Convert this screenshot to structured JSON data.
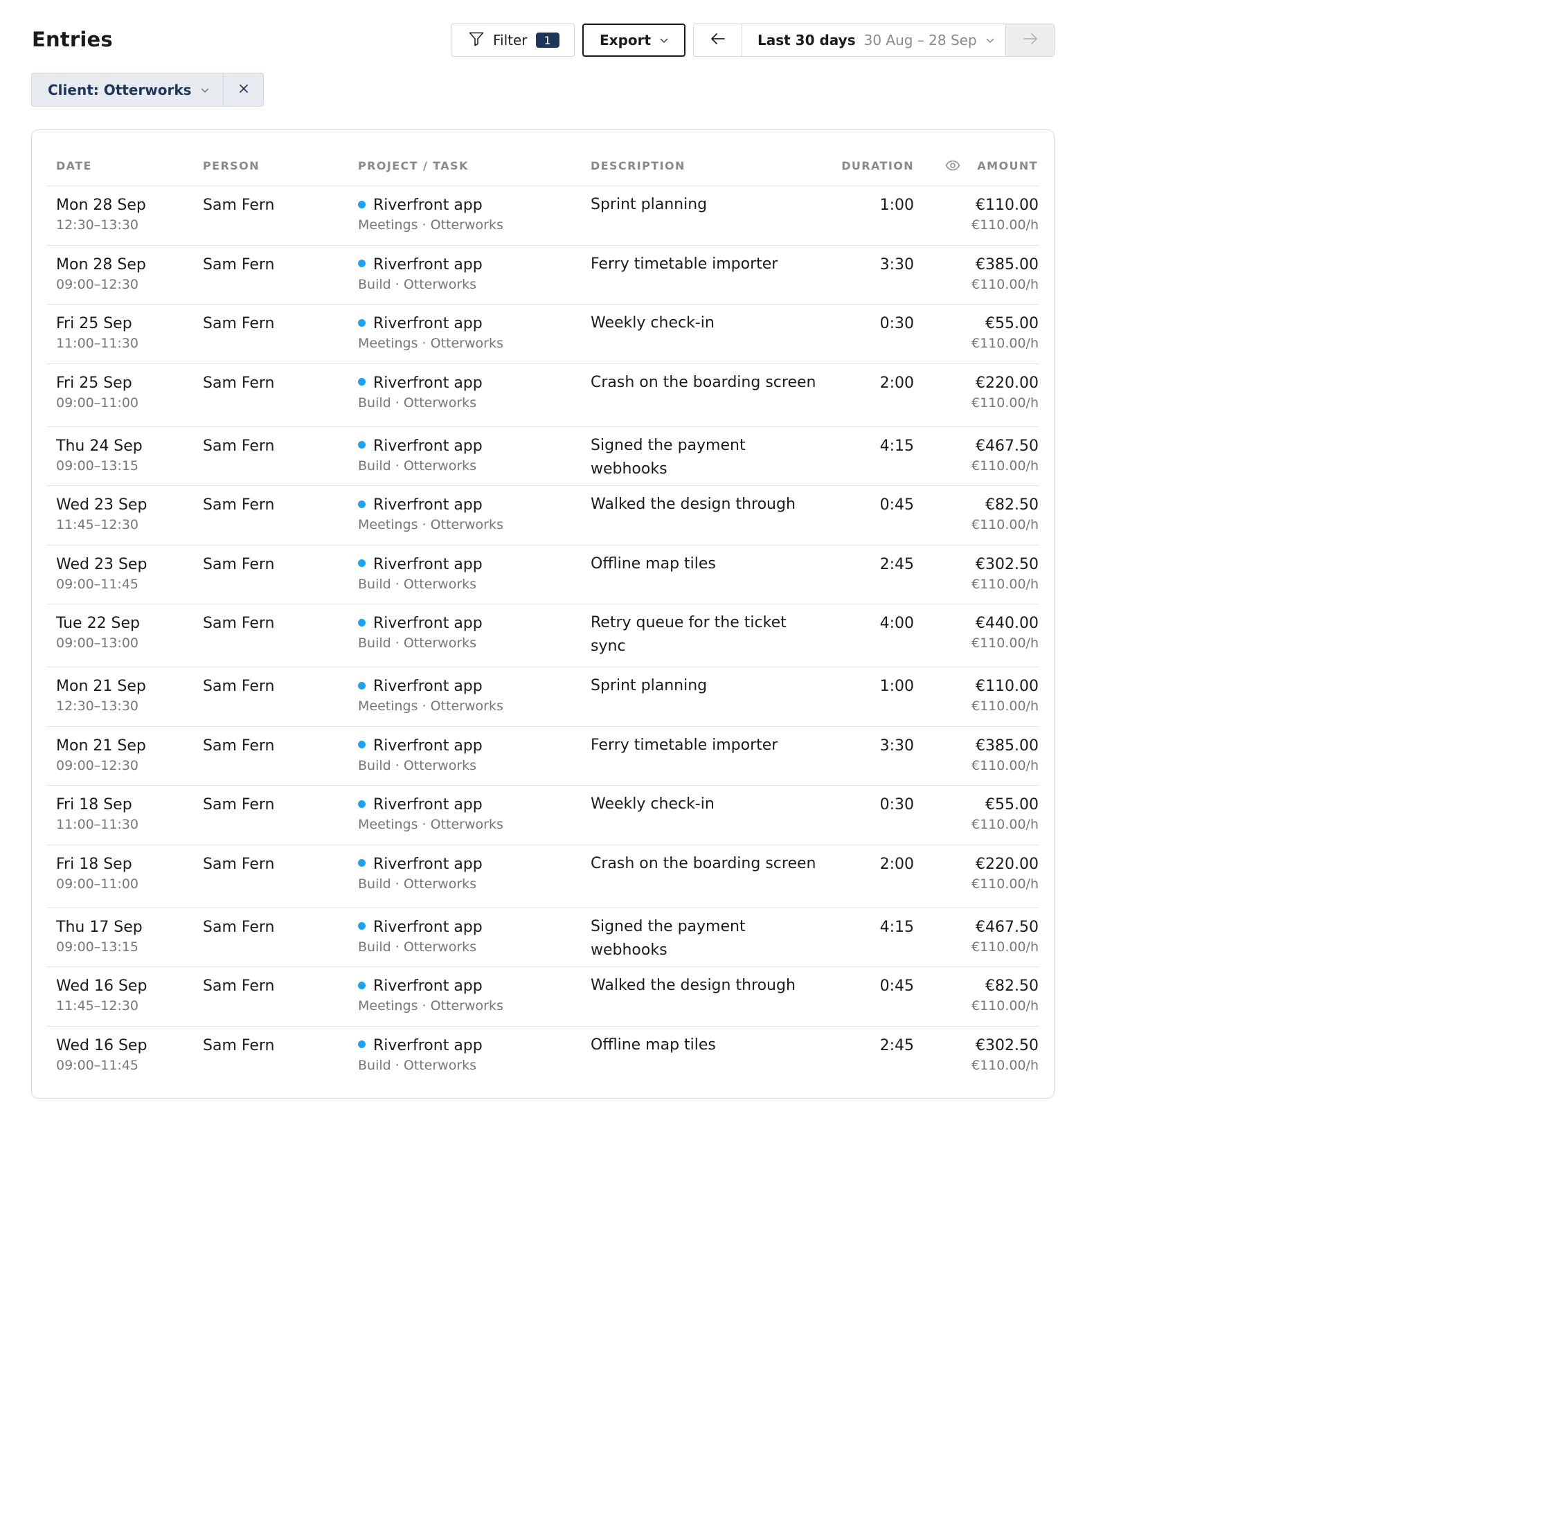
{
  "header": {
    "title": "Entries",
    "filter_label": "Filter",
    "filter_count": "1",
    "export_label": "Export",
    "range_label": "Last 30 days",
    "range_dates": "30 Aug – 28 Sep"
  },
  "active_filter": {
    "label": "Client: Otterworks"
  },
  "table": {
    "columns": {
      "date": "DATE",
      "person": "PERSON",
      "project": "PROJECT / TASK",
      "description": "DESCRIPTION",
      "duration": "DURATION",
      "amount": "AMOUNT"
    },
    "rows": [
      {
        "date": "Mon 28 Sep",
        "time": "12:30–13:30",
        "person": "Sam Fern",
        "project": "Riverfront app",
        "task": "Meetings · Otterworks",
        "description": "Sprint planning",
        "duration": "1:00",
        "amount": "€110.00",
        "rate": "€110.00/h"
      },
      {
        "date": "Mon 28 Sep",
        "time": "09:00–12:30",
        "person": "Sam Fern",
        "project": "Riverfront app",
        "task": "Build · Otterworks",
        "description": "Ferry timetable importer",
        "duration": "3:30",
        "amount": "€385.00",
        "rate": "€110.00/h"
      },
      {
        "date": "Fri 25 Sep",
        "time": "11:00–11:30",
        "person": "Sam Fern",
        "project": "Riverfront app",
        "task": "Meetings · Otterworks",
        "description": "Weekly check-in",
        "duration": "0:30",
        "amount": "€55.00",
        "rate": "€110.00/h"
      },
      {
        "date": "Fri 25 Sep",
        "time": "09:00–11:00",
        "person": "Sam Fern",
        "project": "Riverfront app",
        "task": "Build · Otterworks",
        "description": "Crash on the boarding screen",
        "duration": "2:00",
        "amount": "€220.00",
        "rate": "€110.00/h"
      },
      {
        "date": "Thu 24 Sep",
        "time": "09:00–13:15",
        "person": "Sam Fern",
        "project": "Riverfront app",
        "task": "Build · Otterworks",
        "description": "Signed the payment webhooks",
        "duration": "4:15",
        "amount": "€467.50",
        "rate": "€110.00/h"
      },
      {
        "date": "Wed 23 Sep",
        "time": "11:45–12:30",
        "person": "Sam Fern",
        "project": "Riverfront app",
        "task": "Meetings · Otterworks",
        "description": "Walked the design through",
        "duration": "0:45",
        "amount": "€82.50",
        "rate": "€110.00/h"
      },
      {
        "date": "Wed 23 Sep",
        "time": "09:00–11:45",
        "person": "Sam Fern",
        "project": "Riverfront app",
        "task": "Build · Otterworks",
        "description": "Offline map tiles",
        "duration": "2:45",
        "amount": "€302.50",
        "rate": "€110.00/h"
      },
      {
        "date": "Tue 22 Sep",
        "time": "09:00–13:00",
        "person": "Sam Fern",
        "project": "Riverfront app",
        "task": "Build · Otterworks",
        "description": "Retry queue for the ticket sync",
        "duration": "4:00",
        "amount": "€440.00",
        "rate": "€110.00/h"
      },
      {
        "date": "Mon 21 Sep",
        "time": "12:30–13:30",
        "person": "Sam Fern",
        "project": "Riverfront app",
        "task": "Meetings · Otterworks",
        "description": "Sprint planning",
        "duration": "1:00",
        "amount": "€110.00",
        "rate": "€110.00/h"
      },
      {
        "date": "Mon 21 Sep",
        "time": "09:00–12:30",
        "person": "Sam Fern",
        "project": "Riverfront app",
        "task": "Build · Otterworks",
        "description": "Ferry timetable importer",
        "duration": "3:30",
        "amount": "€385.00",
        "rate": "€110.00/h"
      },
      {
        "date": "Fri 18 Sep",
        "time": "11:00–11:30",
        "person": "Sam Fern",
        "project": "Riverfront app",
        "task": "Meetings · Otterworks",
        "description": "Weekly check-in",
        "duration": "0:30",
        "amount": "€55.00",
        "rate": "€110.00/h"
      },
      {
        "date": "Fri 18 Sep",
        "time": "09:00–11:00",
        "person": "Sam Fern",
        "project": "Riverfront app",
        "task": "Build · Otterworks",
        "description": "Crash on the boarding screen",
        "duration": "2:00",
        "amount": "€220.00",
        "rate": "€110.00/h"
      },
      {
        "date": "Thu 17 Sep",
        "time": "09:00–13:15",
        "person": "Sam Fern",
        "project": "Riverfront app",
        "task": "Build · Otterworks",
        "description": "Signed the payment webhooks",
        "duration": "4:15",
        "amount": "€467.50",
        "rate": "€110.00/h"
      },
      {
        "date": "Wed 16 Sep",
        "time": "11:45–12:30",
        "person": "Sam Fern",
        "project": "Riverfront app",
        "task": "Meetings · Otterworks",
        "description": "Walked the design through",
        "duration": "0:45",
        "amount": "€82.50",
        "rate": "€110.00/h"
      },
      {
        "date": "Wed 16 Sep",
        "time": "09:00–11:45",
        "person": "Sam Fern",
        "project": "Riverfront app",
        "task": "Build · Otterworks",
        "description": "Offline map tiles",
        "duration": "2:45",
        "amount": "€302.50",
        "rate": "€110.00/h"
      }
    ]
  },
  "colors": {
    "accent": "#1d3557",
    "project_dot": "#1aa3f0"
  },
  "icons": [
    "funnel-icon",
    "chevron-down-icon",
    "arrow-left-icon",
    "arrow-right-icon",
    "close-icon",
    "eye-icon"
  ]
}
